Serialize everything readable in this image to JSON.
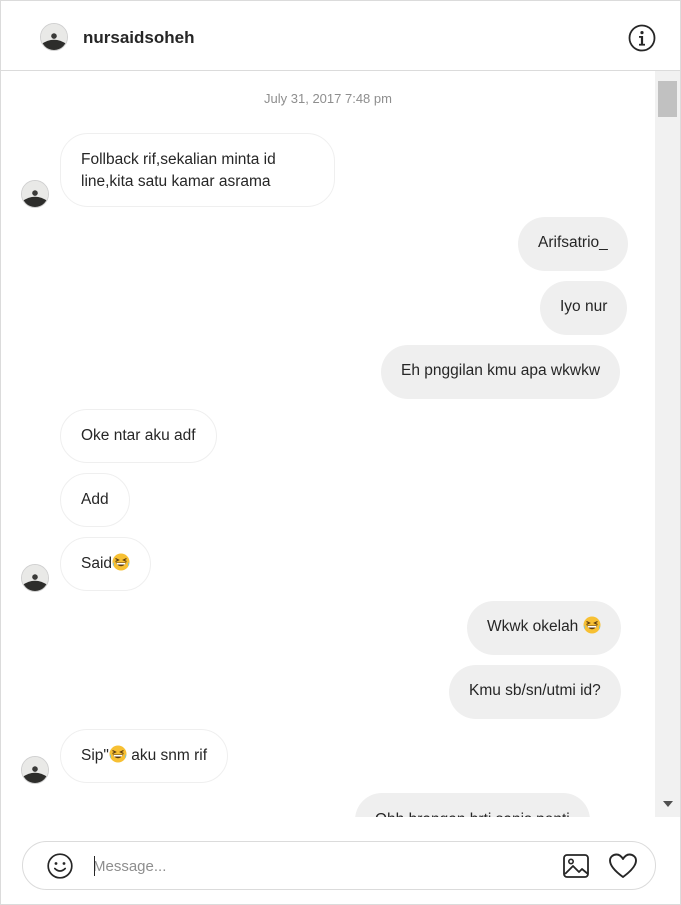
{
  "header": {
    "username": "nursaidsoheh",
    "avatar_icon": "avatar-icon",
    "info_icon": "info-icon"
  },
  "thread": {
    "timestamp": "July 31, 2017 7:48 pm",
    "messages": [
      {
        "from": "them",
        "lines": [
          "Follback rif,sekalian minta id",
          "line,kita satu kamar asrama"
        ]
      },
      {
        "from": "me",
        "text": "Arifsatrio_"
      },
      {
        "from": "me",
        "text": "Iyo nur"
      },
      {
        "from": "me",
        "text": "Eh pnggilan kmu apa wkwkw"
      },
      {
        "from": "them",
        "text": "Oke ntar aku adf"
      },
      {
        "from": "them",
        "text": "Add"
      },
      {
        "from": "them",
        "text": "Said",
        "emoji": "grinning-squinting-face"
      },
      {
        "from": "me",
        "text": "Wkwk okelah ",
        "emoji": "grinning-squinting-face"
      },
      {
        "from": "me",
        "text": "Kmu sb/sn/utmi id?"
      },
      {
        "from": "them",
        "text_before": "Sip\"",
        "emoji": "grinning-squinting-face",
        "text_after": " aku snm rif"
      },
      {
        "from": "me",
        "text": "Ohh brangan brti sanis penti"
      }
    ]
  },
  "composer": {
    "placeholder": "Message...",
    "value": "",
    "emoji_icon": "smiley-icon",
    "image_icon": "image-icon",
    "like_icon": "heart-icon"
  },
  "colors": {
    "outgoing_bubble": "#efefef",
    "incoming_border": "#efefef",
    "text": "#262626",
    "muted": "#8e8e8e",
    "divider": "#dbdbdb"
  }
}
